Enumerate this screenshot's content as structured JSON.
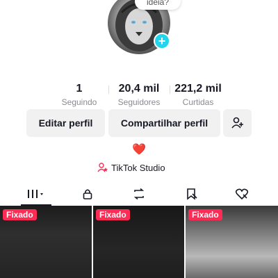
{
  "header": {
    "bubble_text": "ideia?"
  },
  "profile": {
    "avatar_icon": "lion-avatar",
    "add_icon": "plus-icon"
  },
  "stats": [
    {
      "value": "1",
      "label": "Seguindo"
    },
    {
      "value": "20,4 mil",
      "label": "Seguidores"
    },
    {
      "value": "221,2 mil",
      "label": "Curtidas"
    }
  ],
  "actions": {
    "edit_label": "Editar perfil",
    "share_label": "Compartilhar perfil",
    "add_friend_icon": "add-friend-icon"
  },
  "bio": {
    "heart": "❤️"
  },
  "studio": {
    "label": "TikTok Studio",
    "icon": "studio-icon"
  },
  "tabs": [
    {
      "icon": "grid-icon",
      "active": true
    },
    {
      "icon": "lock-icon",
      "active": false
    },
    {
      "icon": "repost-icon",
      "active": false
    },
    {
      "icon": "bookmark-icon",
      "active": false
    },
    {
      "icon": "liked-icon",
      "active": false
    }
  ],
  "videos": [
    {
      "badge": "Fixado"
    },
    {
      "badge": "Fixado"
    },
    {
      "badge": "Fixado"
    }
  ],
  "colors": {
    "accent": "#fe2c55",
    "badge_plus": "#20d5ec",
    "heart": "#e8253f"
  }
}
